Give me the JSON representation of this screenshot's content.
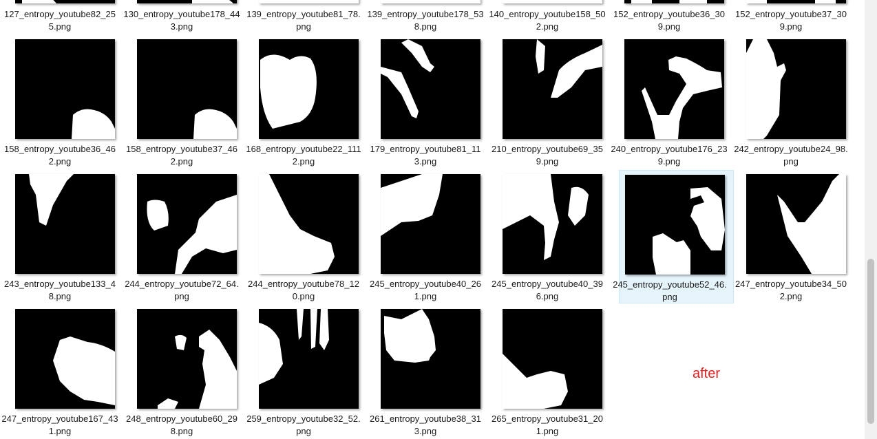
{
  "top_row": [
    {
      "label": "127_entropy_youtube82_255.png"
    },
    {
      "label": "130_entropy_youtube178_443.png"
    },
    {
      "label": "139_entropy_youtube81_78.png"
    },
    {
      "label": "139_entropy_youtube178_538.png"
    },
    {
      "label": "140_entropy_youtube158_502.png"
    },
    {
      "label": "152_entropy_youtube36_309.png"
    },
    {
      "label": "152_entropy_youtube37_309.png"
    }
  ],
  "rows": [
    [
      {
        "label": "158_entropy_youtube36_462.png"
      },
      {
        "label": "158_entropy_youtube37_462.png"
      },
      {
        "label": "168_entropy_youtube22_1112.png"
      },
      {
        "label": "179_entropy_youtube81_113.png"
      },
      {
        "label": "210_entropy_youtube69_359.png"
      },
      {
        "label": "240_entropy_youtube176_239.png"
      },
      {
        "label": "242_entropy_youtube24_98.png"
      }
    ],
    [
      {
        "label": "243_entropy_youtube133_48.png"
      },
      {
        "label": "244_entropy_youtube72_64.png"
      },
      {
        "label": "244_entropy_youtube78_120.png"
      },
      {
        "label": "245_entropy_youtube40_261.png"
      },
      {
        "label": "245_entropy_youtube40_396.png"
      },
      {
        "label": "245_entropy_youtube52_46.png",
        "selected": true
      },
      {
        "label": "247_entropy_youtube34_502.png"
      }
    ],
    [
      {
        "label": "247_entropy_youtube167_431.png"
      },
      {
        "label": "248_entropy_youtube60_298.png"
      },
      {
        "label": "259_entropy_youtube32_52.png"
      },
      {
        "label": "261_entropy_youtube38_313.png"
      },
      {
        "label": "265_entropy_youtube31_201.png"
      }
    ]
  ],
  "annotation": {
    "text": "after",
    "color": "#e02020"
  },
  "colors": {
    "selection_bg": "#e5f3fb",
    "thumb_bg": "#000000",
    "mask_fg": "#ffffff"
  }
}
